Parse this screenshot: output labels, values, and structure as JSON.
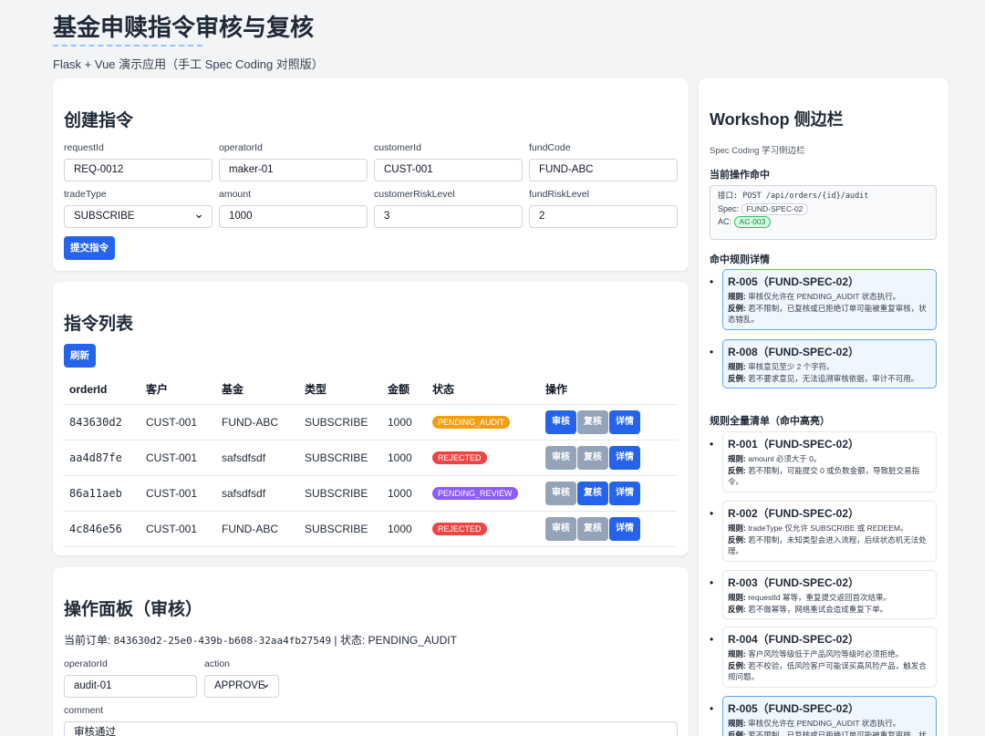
{
  "header": {
    "title": "基金申赎指令审核与复核",
    "subtitle": "Flask + Vue 演示应用（手工 Spec Coding 对照版）"
  },
  "create": {
    "title": "创建指令",
    "fields": [
      {
        "label": "requestId",
        "value": "REQ-0012"
      },
      {
        "label": "operatorId",
        "value": "maker-01"
      },
      {
        "label": "customerId",
        "value": "CUST-001"
      },
      {
        "label": "fundCode",
        "value": "FUND-ABC"
      },
      {
        "label": "tradeType",
        "value": "SUBSCRIBE"
      },
      {
        "label": "amount",
        "value": "1000"
      },
      {
        "label": "customerRiskLevel",
        "value": "3"
      },
      {
        "label": "fundRiskLevel",
        "value": "2"
      }
    ],
    "submit_label": "提交指令"
  },
  "list": {
    "title": "指令列表",
    "refresh_label": "刷新",
    "columns": [
      "orderId",
      "客户",
      "基金",
      "类型",
      "金额",
      "状态",
      "操作"
    ],
    "rows": [
      {
        "orderId": "843630d2",
        "customer": "CUST-001",
        "fund": "FUND-ABC",
        "type": "SUBSCRIBE",
        "amount": "1000",
        "status": "PENDING_AUDIT",
        "status_color": "#f59e0b",
        "actions_enabled": [
          true,
          false,
          true
        ]
      },
      {
        "orderId": "aa4d87fe",
        "customer": "CUST-001",
        "fund": "safsdfsdf",
        "type": "SUBSCRIBE",
        "amount": "1000",
        "status": "REJECTED",
        "status_color": "#ef4444",
        "actions_enabled": [
          false,
          false,
          true
        ]
      },
      {
        "orderId": "86a11aeb",
        "customer": "CUST-001",
        "fund": "safsdfsdf",
        "type": "SUBSCRIBE",
        "amount": "1000",
        "status": "PENDING_REVIEW",
        "status_color": "#8b5cf6",
        "actions_enabled": [
          false,
          true,
          true
        ]
      },
      {
        "orderId": "4c846e56",
        "customer": "CUST-001",
        "fund": "FUND-ABC",
        "type": "SUBSCRIBE",
        "amount": "1000",
        "status": "REJECTED",
        "status_color": "#ef4444",
        "actions_enabled": [
          false,
          false,
          true
        ]
      }
    ],
    "action_labels": [
      "审核",
      "复核",
      "详情"
    ]
  },
  "panel": {
    "title": "操作面板（审核）",
    "current_prefix": "当前订单: ",
    "current_order_id": "843630d2-25e0-439b-b608-32aa4fb27549",
    "current_status": " | 状态: PENDING_AUDIT",
    "operator_label": "operatorId",
    "operator_value": "audit-01",
    "action_label": "action",
    "action_value": "APPROVE",
    "comment_label": "comment",
    "comment_value": "审核通过"
  },
  "sidebar": {
    "title": "Workshop 侧边栏",
    "subtitle": "Spec Coding 学习侧边栏",
    "hit_heading": "当前操作命中",
    "api_line": "接口: POST /api/orders/{id}/audit",
    "spec_prefix": "Spec:",
    "spec_value": "FUND-SPEC-02",
    "ac_prefix": "AC:",
    "ac_value": "AC-003",
    "rules_heading": "命中规则详情",
    "all_heading": "规则全量清单（命中高亮）",
    "rule_label": "规则:",
    "counter_label": "反例:",
    "hit_rules": [
      {
        "title": "R-005（FUND-SPEC-02）",
        "rule": "审核仅允许在 PENDING_AUDIT 状态执行。",
        "counter": "若不限制，已复核或已拒绝订单可能被重复审核，状态错乱。"
      },
      {
        "title": "R-008（FUND-SPEC-02）",
        "rule": "审核意见至少 2 个字符。",
        "counter": "若不要求意见，无法追溯审核依据，审计不可用。"
      }
    ],
    "all_rules": [
      {
        "title": "R-001（FUND-SPEC-02）",
        "rule": "amount 必须大于 0。",
        "counter": "若不限制，可能提交 0 或负数金额，导致脏交易指令。",
        "hit": false
      },
      {
        "title": "R-002（FUND-SPEC-02）",
        "rule": "tradeType 仅允许 SUBSCRIBE 或 REDEEM。",
        "counter": "若不限制，未知类型会进入流程，后续状态机无法处理。",
        "hit": false
      },
      {
        "title": "R-003（FUND-SPEC-02）",
        "rule": "requestId 幂等，重复提交返回首次结果。",
        "counter": "若不做幂等，网络重试会造成重复下单。",
        "hit": false
      },
      {
        "title": "R-004（FUND-SPEC-02）",
        "rule": "客户风险等级低于产品风险等级时必须拒绝。",
        "counter": "若不校验，低风险客户可能误买高风险产品，触发合规问题。",
        "hit": false
      },
      {
        "title": "R-005（FUND-SPEC-02）",
        "rule": "审核仅允许在 PENDING_AUDIT 状态执行。",
        "counter": "若不限制，已复核或已拒绝订单可能被重复审核，状态错乱。",
        "hit": true
      }
    ]
  },
  "colors": {
    "primary": "#2563eb",
    "disabled": "#94a3b8"
  }
}
